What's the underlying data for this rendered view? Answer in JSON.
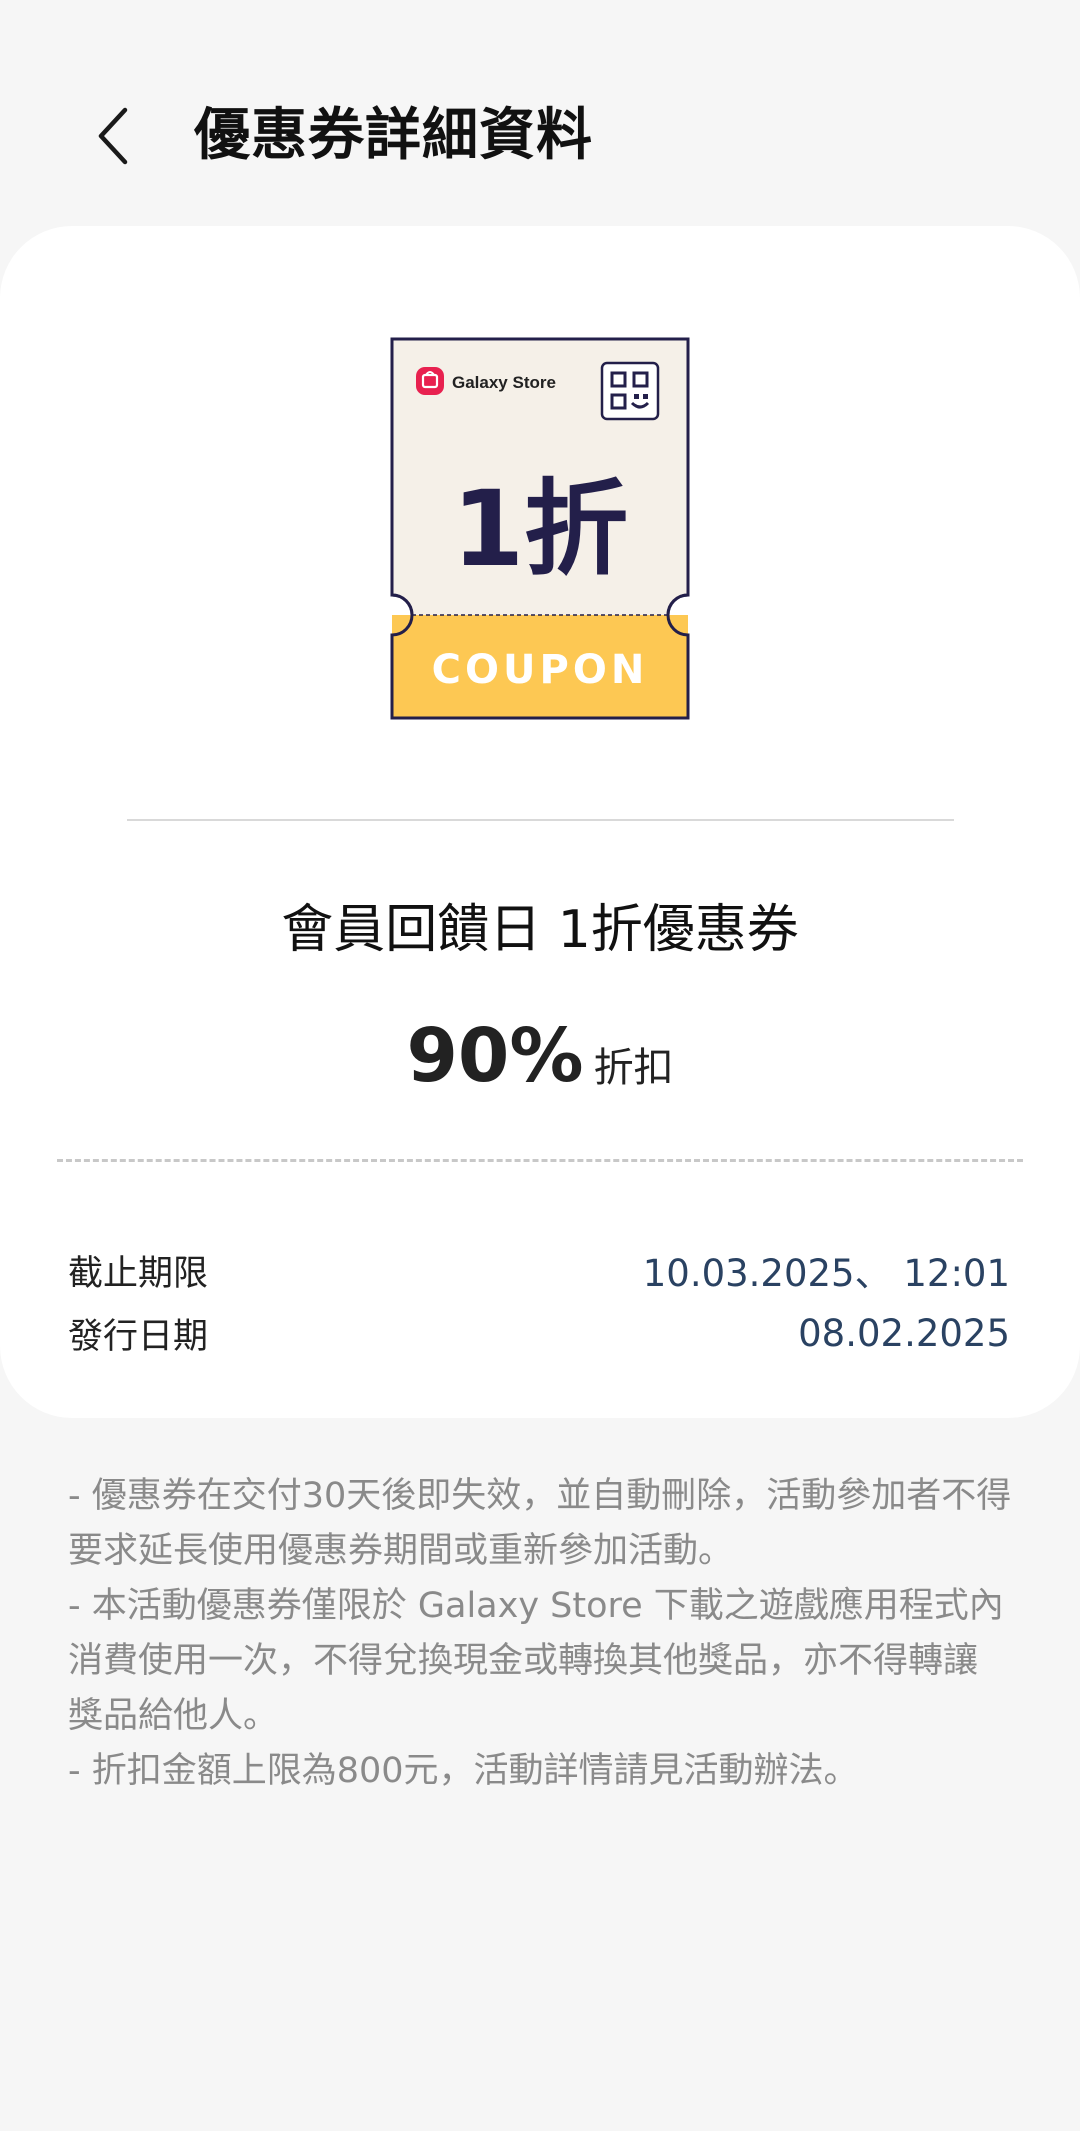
{
  "header": {
    "title": "優惠券詳細資料",
    "back_icon": "chevron-left-icon"
  },
  "coupon_image": {
    "brand": "Galaxy Store",
    "brand_icon": "galaxy-store-icon",
    "qr_icon": "qr-code-icon",
    "value_text": "1折",
    "band_text": "COUPON",
    "colors": {
      "paper": "#f5f0e8",
      "outline": "#231f4a",
      "band": "#fdc853",
      "brand_icon": "#e8214f"
    }
  },
  "coupon": {
    "name": "會員回饋日 1折優惠券",
    "discount_value": "90%",
    "discount_label": "折扣"
  },
  "details": [
    {
      "label": "截止期限",
      "value": "10.03.2025、 12:01"
    },
    {
      "label": "發行日期",
      "value": "08.02.2025"
    }
  ],
  "notes": [
    "- 優惠券在交付30天後即失效，並自動刪除，活動參加者不得",
    "要求延長使用優惠券期間或重新參加活動。",
    "- 本活動優惠券僅限於 Galaxy Store 下載之遊戲應用程式內",
    "消費使用一次，不得兌換現金或轉換其他獎品，亦不得轉讓",
    "獎品給他人。",
    "- 折扣金額上限為800元，活動詳情請見活動辦法。"
  ]
}
